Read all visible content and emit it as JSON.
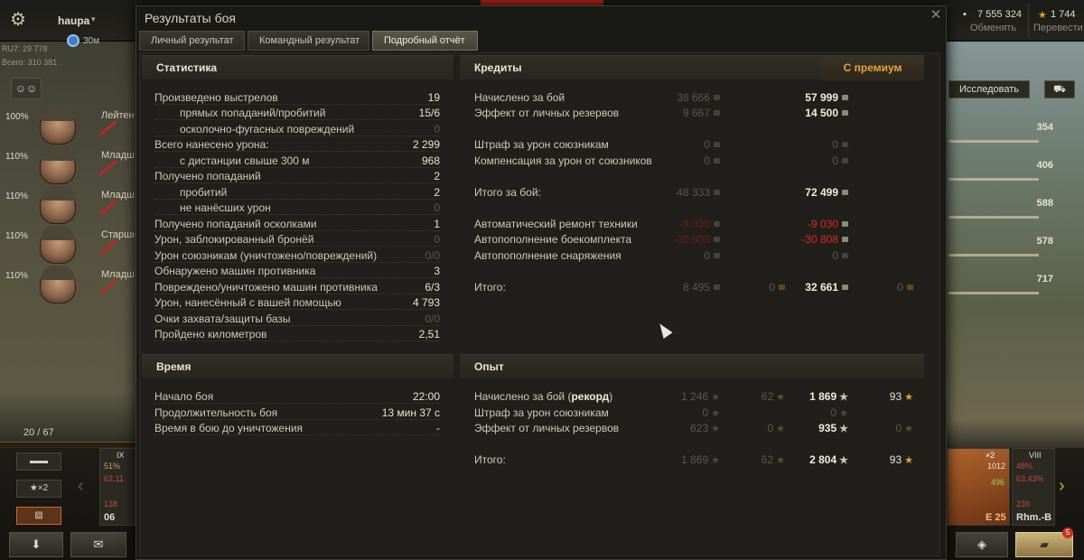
{
  "topbar": {
    "player": "haupa",
    "timer": "30м",
    "server": "RU7: 29 778",
    "total": "Всего: 310 381",
    "credits": "7 555 324",
    "exchange": "Обменять",
    "gold": "1 744",
    "transfer": "Перевести"
  },
  "crew": [
    {
      "pct": "100%",
      "role": "Лейтен"
    },
    {
      "pct": "110%",
      "role": "Младш"
    },
    {
      "pct": "110%",
      "role": "Младш"
    },
    {
      "pct": "110%",
      "role": "Старши"
    },
    {
      "pct": "110%",
      "role": "Младш"
    }
  ],
  "garage": {
    "counter": "20 / 67",
    "bonus_label": "★×2",
    "tanks": [
      {
        "tier": "IX",
        "stat1": "51%",
        "stat2": "62,11",
        "stat3": "138",
        "name": "06"
      },
      {
        "tier": "VIII",
        "stat1": "48%",
        "stat2": "63,43%",
        "stat3": "239",
        "name": "Rhm.-B"
      }
    ],
    "selected_tank": {
      "name": "E 25",
      "bonus": "×2",
      "xp": "1012",
      "free_xp": "496"
    },
    "notification_count": "5"
  },
  "right_panel": {
    "research": "Исследовать",
    "values": [
      "354",
      "406",
      "588",
      "578",
      "717"
    ]
  },
  "dialog": {
    "title": "Результаты боя",
    "tabs": [
      "Личный результат",
      "Командный результат",
      "Подробный отчёт"
    ],
    "active_tab": 2
  },
  "statistics": {
    "title": "Статистика",
    "rows": [
      {
        "label": "Произведено выстрелов",
        "value": "19",
        "sub": false,
        "dim": false
      },
      {
        "label": "прямых попаданий/пробитий",
        "value": "15/6",
        "sub": true,
        "dim": false
      },
      {
        "label": "осколочно-фугасных повреждений",
        "value": "0",
        "sub": true,
        "dim": true
      },
      {
        "label": "Всего нанесено урона:",
        "value": "2 299",
        "sub": false,
        "dim": false
      },
      {
        "label": "с дистанции свыше 300 м",
        "value": "968",
        "sub": true,
        "dim": false
      },
      {
        "label": "Получено попаданий",
        "value": "2",
        "sub": false,
        "dim": false
      },
      {
        "label": "пробитий",
        "value": "2",
        "sub": true,
        "dim": false
      },
      {
        "label": "не нанёсших урон",
        "value": "0",
        "sub": true,
        "dim": true
      },
      {
        "label": "Получено попаданий осколками",
        "value": "1",
        "sub": false,
        "dim": false
      },
      {
        "label": "Урон, заблокированный бронёй",
        "value": "0",
        "sub": false,
        "dim": true
      },
      {
        "label": "Урон союзникам (уничтожено/повреждений)",
        "value": "0/0",
        "sub": false,
        "dim": true
      },
      {
        "label": "Обнаружено машин противника",
        "value": "3",
        "sub": false,
        "dim": false
      },
      {
        "label": "Повреждено/уничтожено машин противника",
        "value": "6/3",
        "sub": false,
        "dim": false
      },
      {
        "label": "Урон, нанесённый с вашей помощью",
        "value": "4 793",
        "sub": false,
        "dim": false
      },
      {
        "label": "Очки захвата/защиты базы",
        "value": "0/0",
        "sub": false,
        "dim": true
      },
      {
        "label": "Пройдено километров",
        "value": "2,51",
        "sub": false,
        "dim": false
      }
    ]
  },
  "time": {
    "title": "Время",
    "rows": [
      {
        "label": "Начало боя",
        "value": "22:00"
      },
      {
        "label": "Продолжительность боя",
        "value": "13 мин 37 с"
      },
      {
        "label": "Время в бою до уничтожения",
        "value": "-"
      }
    ]
  },
  "credits": {
    "title": "Кредиты",
    "premium_label": "С премиум",
    "rows": [
      {
        "label": "Начислено за бой",
        "base": "38 666",
        "prem": "57 999",
        "kind": "normal"
      },
      {
        "label": "Эффект от личных резервов",
        "base": "9 667",
        "prem": "14 500",
        "kind": "normal"
      },
      {
        "label": "Штраф за урон союзникам",
        "base": "0",
        "prem": "0",
        "kind": "zero"
      },
      {
        "label": "Компенсация за урон от союзников",
        "base": "0",
        "prem": "0",
        "kind": "zero"
      },
      {
        "label": "Итого за бой:",
        "base": "48 333",
        "prem": "72 499",
        "kind": "normal"
      },
      {
        "label": "Автоматический ремонт техники",
        "base": "-9 030",
        "prem": "-9 030",
        "kind": "red"
      },
      {
        "label": "Автопополнение боекомплекта",
        "base": "-30 808",
        "prem": "-30 808",
        "kind": "red"
      },
      {
        "label": "Автопополнение снаряжения",
        "base": "0",
        "prem": "0",
        "kind": "zero"
      }
    ],
    "total": {
      "label": "Итого:",
      "base": "8 495",
      "base_gold": "0",
      "prem": "32 661",
      "prem_gold": "0"
    }
  },
  "experience": {
    "title": "Опыт",
    "rows": [
      {
        "label": "Начислено за бой",
        "record": "рекорд",
        "base": "1 246",
        "base_free": "62",
        "prem": "1 869",
        "prem_free": "93"
      },
      {
        "label": "Штраф за урон союзникам",
        "record": "",
        "base": "0",
        "base_free": "",
        "prem": "0",
        "prem_free": ""
      },
      {
        "label": "Эффект от личных резервов",
        "record": "",
        "base": "623",
        "base_free": "0",
        "prem": "935",
        "prem_free": "0"
      }
    ],
    "total": {
      "label": "Итого:",
      "base": "1 869",
      "base_free": "62",
      "prem": "2 804",
      "prem_free": "93"
    }
  }
}
